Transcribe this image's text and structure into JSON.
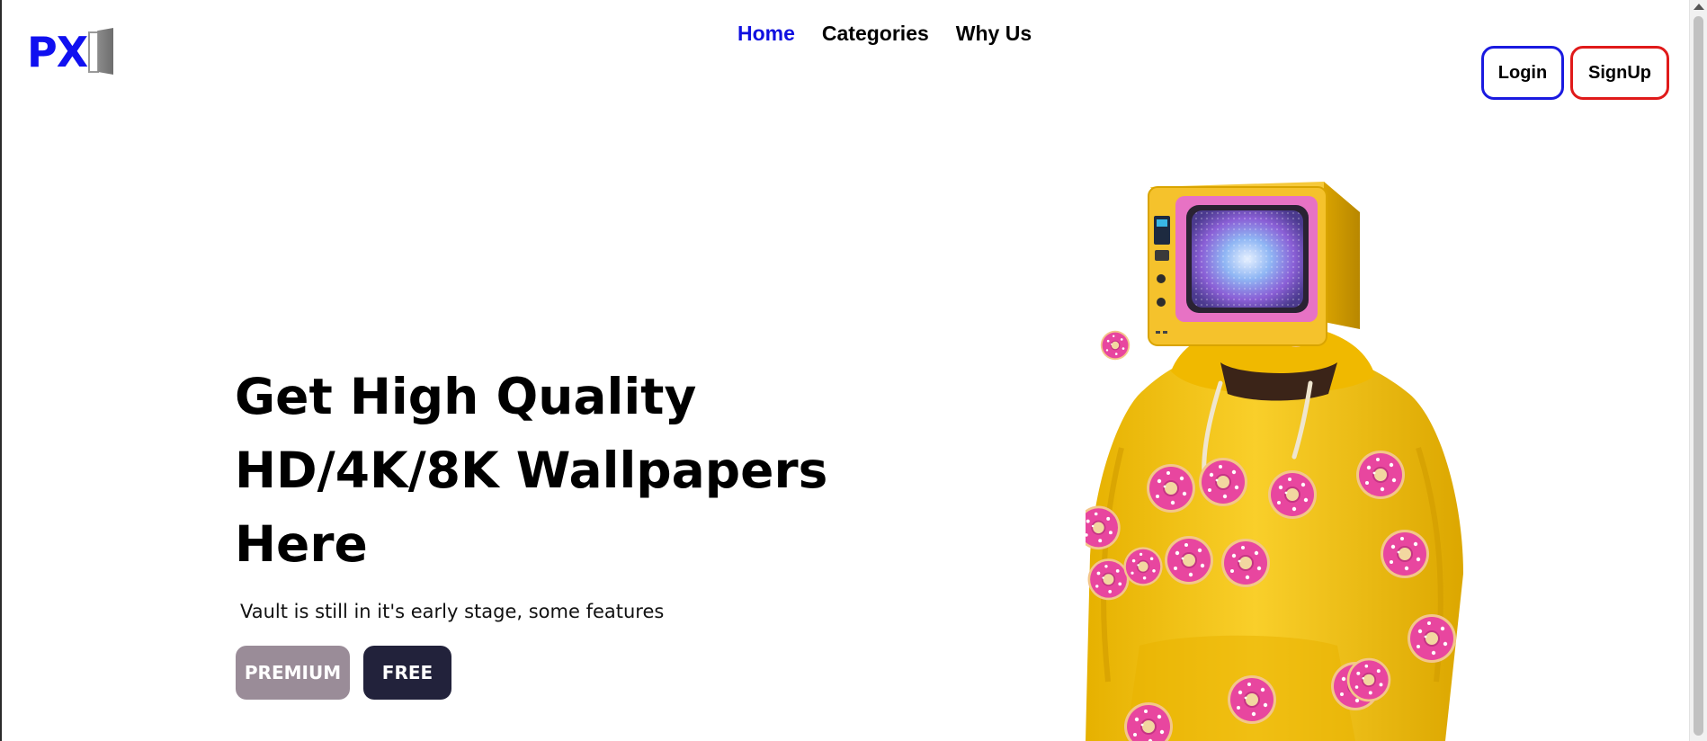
{
  "brand": {
    "logo_text": "PX",
    "logo_color": "#1010f0"
  },
  "nav": {
    "items": [
      {
        "label": "Home",
        "active": true
      },
      {
        "label": "Categories",
        "active": false
      },
      {
        "label": "Why Us",
        "active": false
      }
    ],
    "active_color": "#1010e0"
  },
  "auth": {
    "login_label": "Login",
    "signup_label": "SignUp",
    "login_border_color": "#1a1ae0",
    "signup_border_color": "#e01a1a"
  },
  "hero": {
    "title_line1": "Get High Quality",
    "title_line2": "HD/4K/8K Wallpapers",
    "title_line3": "Here",
    "subtitle": "Vault is still in it's early stage, some features",
    "premium_label": "PREMIUM",
    "free_label": "FREE",
    "premium_color": "#9a8c98",
    "free_color": "#22223b"
  },
  "illustration": {
    "icon": "tv-head-person-in-donut-hoodie",
    "tv_color": "#f2c12e",
    "hoodie_color": "#f7c71d",
    "donut_color": "#e64aa8"
  }
}
